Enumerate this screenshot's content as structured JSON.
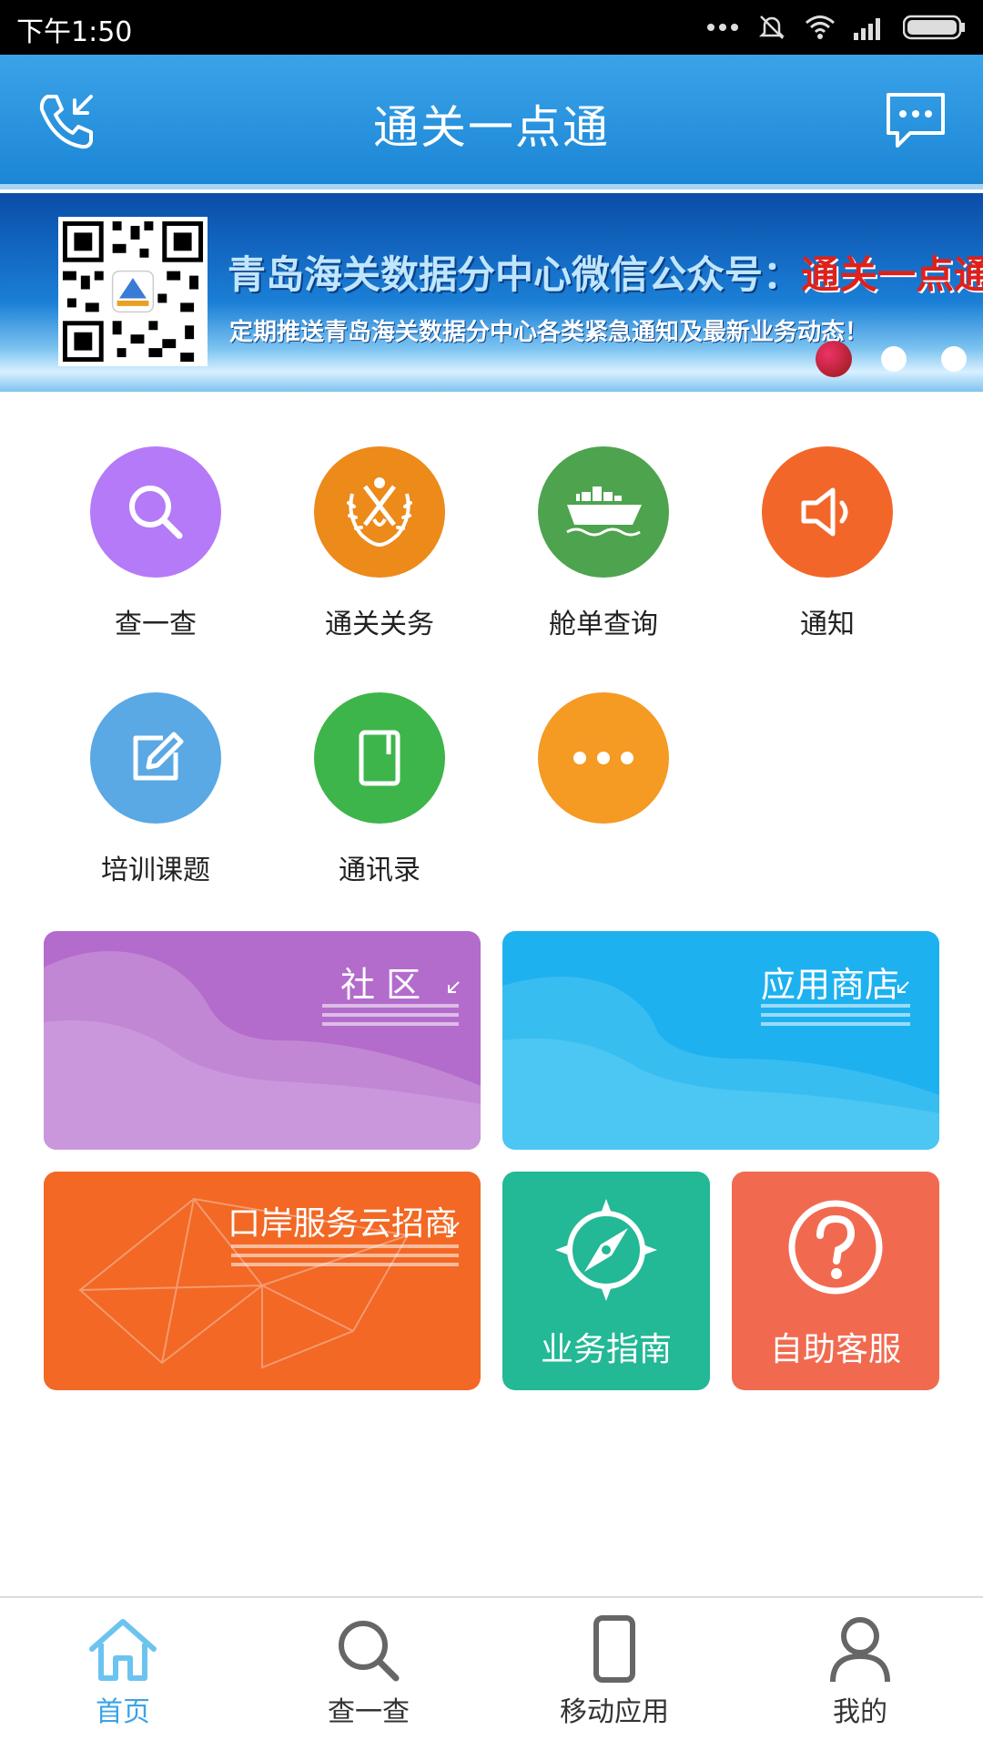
{
  "status_bar": {
    "time": "下午1:50"
  },
  "header": {
    "title": "通关一点通"
  },
  "banner": {
    "line1_prefix": "青岛海关数据分中心微信公众号：",
    "line1_highlight": "通关一点通",
    "line2": "定期推送青岛海关数据分中心各类紧急通知及最新业务动态！",
    "dots": 3,
    "active_dot": 0
  },
  "grid": [
    {
      "label": "查一查",
      "color": "#b57af7",
      "icon": "search-icon"
    },
    {
      "label": "通关关务",
      "color": "#ec8a1a",
      "icon": "customs-emblem-icon"
    },
    {
      "label": "舱单查询",
      "color": "#4ea34f",
      "icon": "cargo-ship-icon"
    },
    {
      "label": "通知",
      "color": "#f3662a",
      "icon": "speaker-icon"
    },
    {
      "label": "培训课题",
      "color": "#5aa8e4",
      "icon": "edit-icon"
    },
    {
      "label": "通讯录",
      "color": "#3db54a",
      "icon": "phonebook-icon"
    },
    {
      "label": "",
      "color": "#f59a23",
      "icon": "more-icon"
    }
  ],
  "tiles": {
    "community": {
      "title": "社 区",
      "color": "#b36ccb"
    },
    "app_store": {
      "title": "应用商店",
      "color": "#1eb1ef"
    },
    "port_service": {
      "title": "口岸服务云招商",
      "color": "#f26824"
    },
    "business_guide": {
      "title": "业务指南",
      "color": "#23b896",
      "icon": "compass-icon"
    },
    "self_service": {
      "title": "自助客服",
      "color": "#f16a50",
      "icon": "help-icon"
    }
  },
  "tabbar": {
    "items": [
      {
        "label": "首页",
        "icon": "home-icon",
        "active": true
      },
      {
        "label": "查一查",
        "icon": "search-icon",
        "active": false
      },
      {
        "label": "移动应用",
        "icon": "phone-icon",
        "active": false
      },
      {
        "label": "我的",
        "icon": "user-icon",
        "active": false
      }
    ]
  }
}
